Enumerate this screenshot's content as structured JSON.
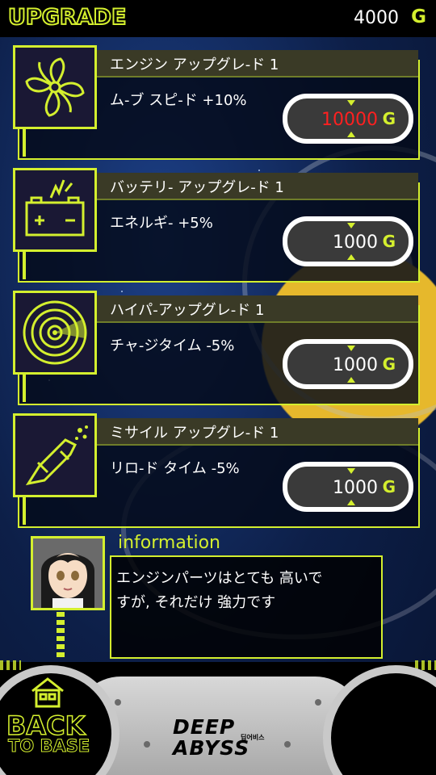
{
  "header": {
    "title": "UPGRADE",
    "gold": "4000",
    "gold_unit": "G"
  },
  "upgrades": [
    {
      "icon": "fan-blade-icon",
      "title": "エンジン アップグレ-ド 1",
      "description": "ム-ブ スピ-ド +10%",
      "price": "10000",
      "price_unit": "G",
      "price_color": "#ff2020"
    },
    {
      "icon": "battery-icon",
      "title": "バッテリ- アップグレ-ド 1",
      "description": "エネルギ- +5%",
      "price": "1000",
      "price_unit": "G",
      "price_color": "#ffffff"
    },
    {
      "icon": "radar-icon",
      "title": "ハイパ-アップグレ-ド 1",
      "description": "チャ-ジタイム -5%",
      "price": "1000",
      "price_unit": "G",
      "price_color": "#ffffff"
    },
    {
      "icon": "missile-icon",
      "title": "ミサイル アップグレ-ド 1",
      "description": "リロ-ド タイム -5%",
      "price": "1000",
      "price_unit": "G",
      "price_color": "#ffffff"
    }
  ],
  "information": {
    "label": "information",
    "message_line1": "エンジンパーツはとても 高いで",
    "message_line2": "すが, それだけ 強力です"
  },
  "footer": {
    "back_label": "BACK",
    "back_sub": "TO BASE",
    "logo_line1": "DEEP",
    "logo_line2": "ABYSS",
    "logo_small": "딥어비스"
  },
  "colors": {
    "accent": "#d4ef2e",
    "price_alert": "#ff2020"
  }
}
